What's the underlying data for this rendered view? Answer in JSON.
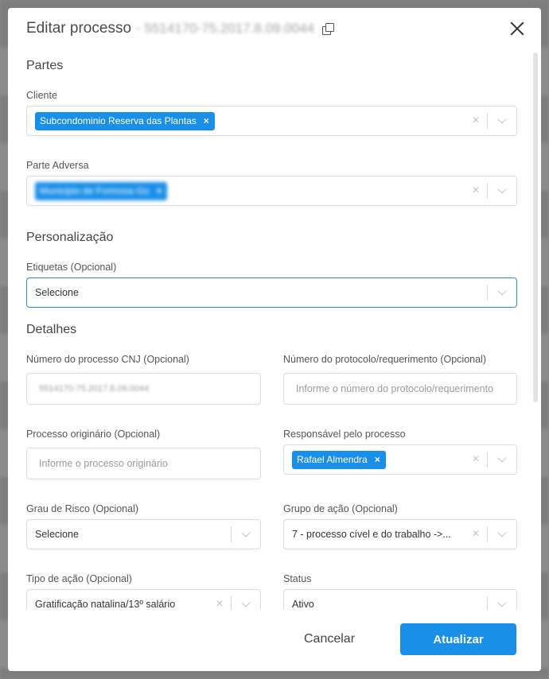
{
  "header": {
    "title": "Editar processo",
    "process_number": "- 5514170-75.2017.8.09.0044"
  },
  "sections": {
    "partes": "Partes",
    "personalizacao": "Personalização",
    "detalhes": "Detalhes"
  },
  "fields": {
    "cliente": {
      "label": "Cliente",
      "chip": "Subcondominio Reserva das Plantas",
      "chip_remove": "×"
    },
    "parte_adversa": {
      "label": "Parte Adversa",
      "chip": "Municipio de Formosa Go",
      "chip_remove": "×"
    },
    "etiquetas": {
      "label": "Etiquetas (Opcional)",
      "value": "Selecione"
    },
    "numero_cnj": {
      "label": "Número do processo CNJ (Opcional)",
      "value": "5514170-75.2017.8.09.0044"
    },
    "protocolo": {
      "label": "Número do protocolo/requerimento (Opcional)",
      "placeholder": "Informe o número do protocolo/requerimento"
    },
    "originario": {
      "label": "Processo originário (Opcional)",
      "placeholder": "Informe o processo originário"
    },
    "responsavel": {
      "label": "Responsável pelo processo",
      "chip": "Rafael Almendra",
      "chip_remove": "×"
    },
    "grau_risco": {
      "label": "Grau de Risco (Opcional)",
      "value": "Selecione"
    },
    "grupo_acao": {
      "label": "Grupo de ação (Opcional)",
      "value": "7 - processo cível e do trabalho ->..."
    },
    "tipo_acao": {
      "label": "Tipo de ação (Opcional)",
      "value": "Gratificação natalina/13º salário"
    },
    "status": {
      "label": "Status",
      "value": "Ativo"
    }
  },
  "clear_glyph": "×",
  "footer": {
    "cancel": "Cancelar",
    "update": "Atualizar"
  },
  "colors": {
    "primary": "#1a8fe8",
    "focus_border": "#2a8fc7"
  }
}
